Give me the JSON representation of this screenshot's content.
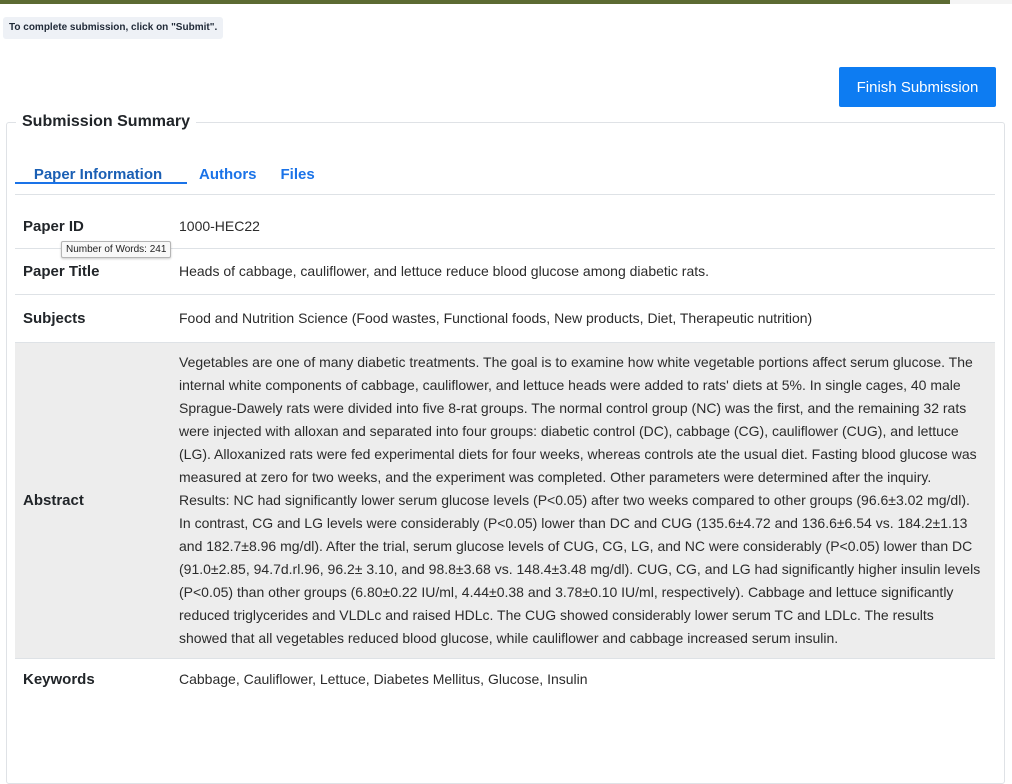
{
  "notice": "To complete submission, click on \"Submit\".",
  "finish_button": "Finish Submission",
  "summary_title": "Submission Summary",
  "tabs": [
    {
      "label": "Paper Information",
      "active": true
    },
    {
      "label": "Authors",
      "active": false
    },
    {
      "label": "Files",
      "active": false
    }
  ],
  "rows": {
    "paper_id": {
      "label": "Paper ID",
      "value": "1000-HEC22"
    },
    "paper_title": {
      "label": "Paper Title",
      "value": "Heads of cabbage, cauliflower, and lettuce reduce blood glucose among diabetic rats."
    },
    "subjects": {
      "label": "Subjects",
      "value": "Food and Nutrition Science (Food wastes, Functional foods, New products, Diet, Therapeutic nutrition)"
    },
    "abstract": {
      "label": "Abstract",
      "value": "Vegetables are one of many diabetic treatments. The goal is to examine how white vegetable portions affect serum glucose. The internal white components of cabbage, cauliflower, and lettuce heads were added to rats' diets at 5%. In single cages, 40 male Sprague-Dawely rats were divided into five 8-rat groups. The normal control group (NC) was the first, and the remaining 32 rats were injected with alloxan and separated into four groups: diabetic control (DC), cabbage (CG), cauliflower (CUG), and lettuce (LG). Alloxanized rats were fed experimental diets for four weeks, whereas controls ate the usual diet. Fasting blood glucose was measured at zero for two weeks, and the experiment was completed. Other parameters were determined after the inquiry. Results: NC had significantly lower serum glucose levels (P<0.05) after two weeks compared to other groups (96.6±3.02 mg/dl). In contrast, CG and LG levels were considerably (P<0.05) lower than DC and CUG (135.6±4.72 and 136.6±6.54 vs. 184.2±1.13 and 182.7±8.96 mg/dl). After the trial, serum glucose levels of CUG, CG, LG, and NC were considerably (P<0.05) lower than DC (91.0±2.85, 94.7d.rl.96, 96.2± 3.10, and 98.8±3.68 vs. 148.4±3.48 mg/dl). CUG, CG, and LG had significantly higher insulin levels (P<0.05) than other groups (6.80±0.22 IU/ml, 4.44±0.38 and 3.78±0.10 IU/ml, respectively). Cabbage and lettuce significantly reduced triglycerides and VLDLc and raised HDLc. The CUG showed considerably lower serum TC and LDLc. The results showed that all vegetables reduced blood glucose, while cauliflower and cabbage increased serum insulin."
    },
    "keywords": {
      "label": "Keywords",
      "value": "Cabbage, Cauliflower, Lettuce, Diabetes Mellitus, Glucose, Insulin"
    }
  },
  "tooltip": "Number of Words: 241",
  "colors": {
    "accent": "#0d7cf2",
    "top_bar": "#5c6b32",
    "abstract_bg": "#ededed"
  }
}
